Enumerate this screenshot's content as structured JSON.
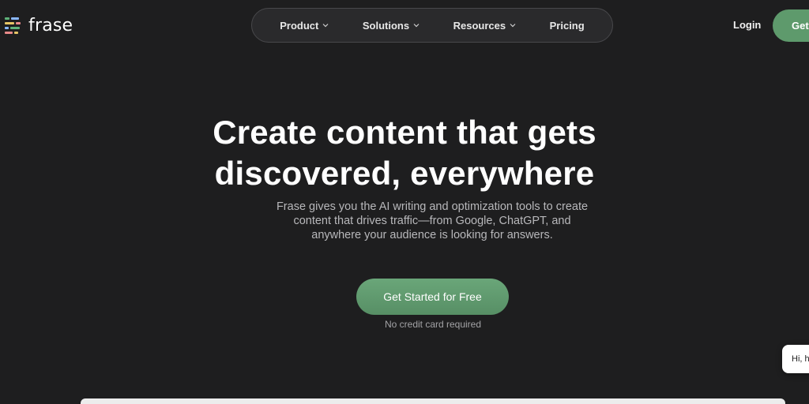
{
  "header": {
    "logo_text": "frase",
    "nav": [
      {
        "label": "Product",
        "has_dropdown": true
      },
      {
        "label": "Solutions",
        "has_dropdown": true
      },
      {
        "label": "Resources",
        "has_dropdown": true
      },
      {
        "label": "Pricing",
        "has_dropdown": false
      }
    ],
    "login_label": "Login",
    "cta_label": "Get"
  },
  "hero": {
    "title_line1": "Create content that gets",
    "title_line2": "discovered, everywhere",
    "subtitle_line1": "Frase gives you the AI writing and optimization tools to create",
    "subtitle_line2": "content that drives traffic—from Google, ChatGPT, and",
    "subtitle_line3": "anywhere your audience is looking for answers.",
    "cta_label": "Get Started for Free",
    "note": "No credit card required"
  },
  "chat": {
    "bubble_text": "Hi, he"
  },
  "colors": {
    "background": "#1e1e1f",
    "accent": "#5e9a6c",
    "nav_pill": "#2a2a2c",
    "subtitle": "#b8b8bb"
  },
  "icons": {
    "logo": "frase-logo-mark",
    "dropdown": "chevron-down-icon"
  }
}
